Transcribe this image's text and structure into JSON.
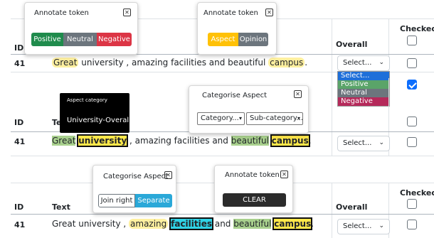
{
  "table": {
    "col_id": "ID",
    "col_text": "Text",
    "col_overall": "Overall",
    "col_checked": "Checked"
  },
  "rows": {
    "id": "41",
    "sentence1": {
      "w1": "Great",
      "rest": " university , amazing facilities and beautiful ",
      "w_campus": "campus",
      "end": "."
    },
    "sentence2": {
      "w1": "Great",
      "w2": "university",
      "mid": " , amazing facilities and ",
      "w_beautiful": "beautiful",
      "w_campus": "campus",
      "end": "."
    },
    "sentence3": {
      "a": "Great university ,  ",
      "w_amazing": "amazing",
      "w_facilities": "facilities",
      "and": " and ",
      "w_beautiful": "beautiful",
      "w_campus": "campus",
      "end": "."
    }
  },
  "overall_select": {
    "value": "Select...",
    "options": [
      "Select...",
      "Positive",
      "Neutral",
      "Negative"
    ]
  },
  "popups": {
    "annotate_token_title": "Annotate token",
    "positive": "Positive",
    "neutral": "Neutral",
    "negative": "Negative",
    "aspect": "Aspect",
    "opinion": "Opinion",
    "categorise_title": "Categorise Aspect",
    "category_placeholder": "Category...",
    "subcategory_placeholder": "Sub-category...",
    "join_right": "Join right",
    "separate": "Separate",
    "clear": "CLEAR",
    "close_symbol": "✕"
  },
  "tooltip": {
    "title": "Aspect category",
    "value": "University-Overall"
  },
  "colors": {
    "positive": "#1f8b4c",
    "neutral": "#6c757d",
    "negative": "#dc3545",
    "aspect": "#ffc107",
    "opinion": "#6c757d",
    "select_highlight": "#1e6fd9",
    "option_positive": "#5aa469",
    "option_neutral": "#6c757d",
    "option_negative": "#b5295a",
    "separate": "#2aa8d8",
    "clear_bg": "#2b2b2b",
    "checkbox_checked": "#0d6efd"
  }
}
